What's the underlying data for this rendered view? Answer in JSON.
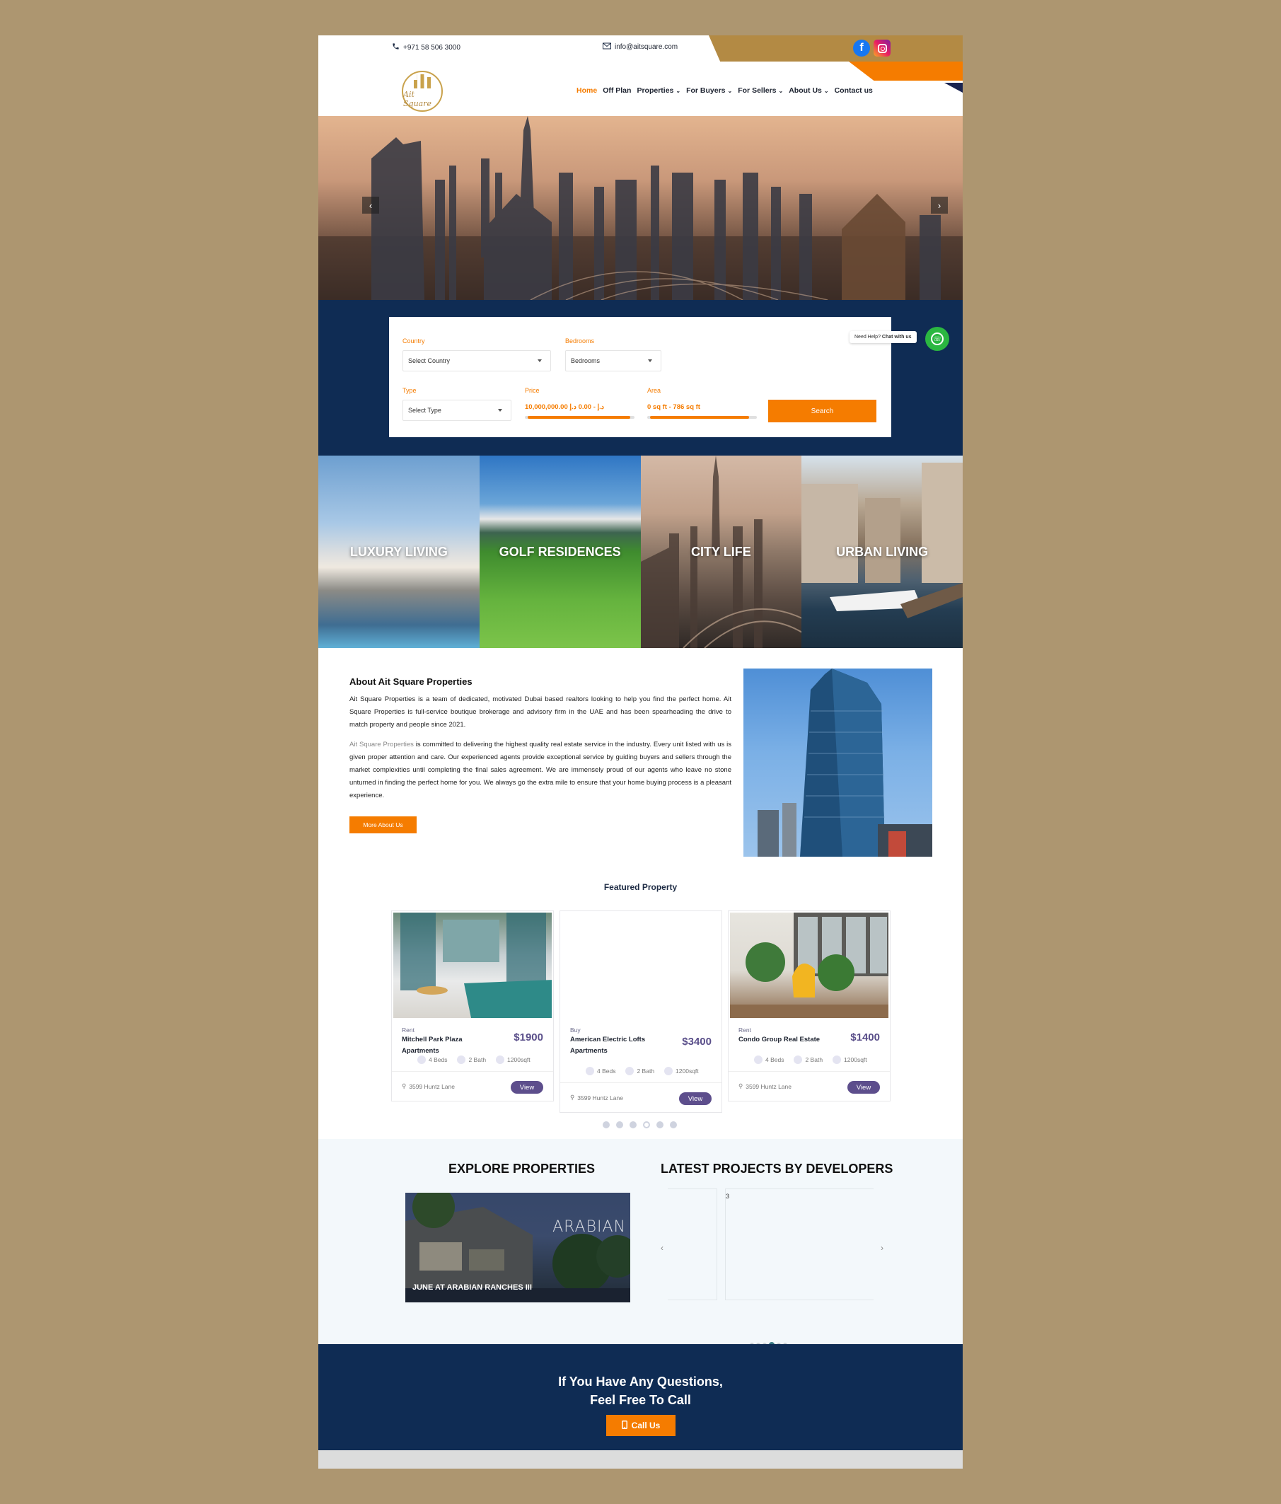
{
  "topbar": {
    "phone": "+971 58 506 3000",
    "email": "info@aitsquare.com",
    "social": [
      "facebook-icon",
      "instagram-icon"
    ]
  },
  "logo": {
    "text": "Ait Square"
  },
  "nav": {
    "items": [
      {
        "label": "Home",
        "active": true,
        "dropdown": false
      },
      {
        "label": "Off Plan",
        "active": false,
        "dropdown": false
      },
      {
        "label": "Properties",
        "active": false,
        "dropdown": true
      },
      {
        "label": "For Buyers",
        "active": false,
        "dropdown": true
      },
      {
        "label": "For Sellers",
        "active": false,
        "dropdown": true
      },
      {
        "label": "About Us",
        "active": false,
        "dropdown": true
      },
      {
        "label": "Contact us",
        "active": false,
        "dropdown": false
      }
    ]
  },
  "hero": {
    "prev": "‹",
    "next": "›"
  },
  "search": {
    "country_label": "Country",
    "country_value": "Select Country",
    "bedrooms_label": "Bedrooms",
    "bedrooms_value": "Bedrooms",
    "type_label": "Type",
    "type_value": "Select Type",
    "price_label": "Price",
    "price_value": "10,000,000.00 د.إ - 0.00 د.إ",
    "area_label": "Area",
    "area_value": "0 sq ft - 786 sq ft",
    "button": "Search"
  },
  "help": {
    "prefix": "Need Help?",
    "strong": "Chat with us"
  },
  "tiles": [
    "LUXURY LIVING",
    "GOLF RESIDENCES",
    "CITY LIFE",
    "URBAN LIVING"
  ],
  "about": {
    "title": "About Ait Square Properties",
    "p1": "Ait Square Properties is a team of dedicated, motivated Dubai based realtors looking to help you find the perfect home. Ait Square Properties is full-service boutique brokerage and advisory firm in the UAE and has been spearheading the drive to match property and people since 2021.",
    "p2_highlight": "Ait Square Properties",
    "p2": " is committed to delivering the highest quality real estate service in the industry. Every unit listed with us is given proper attention and care. Our experienced agents provide exceptional service by guiding buyers and sellers through the market complexities until completing the final sales agreement. We are immensely proud of our agents who leave no stone unturned in finding the perfect home for you. We always go the extra mile to ensure that your home buying process is a pleasant experience.",
    "button": "More About Us"
  },
  "featured": {
    "title": "Featured Property",
    "cards": [
      {
        "type": "Rent",
        "name": "Mitchell Park Plaza Apartments",
        "price": "$1900",
        "beds": "4 Beds",
        "bath": "2 Bath",
        "area": "1200sqft",
        "location": "3599 Huntz Lane",
        "view": "View"
      },
      {
        "type": "Buy",
        "name": "American Electric Lofts Apartments",
        "price": "$3400",
        "beds": "4 Beds",
        "bath": "2 Bath",
        "area": "1200sqft",
        "location": "3599 Huntz Lane",
        "view": "View"
      },
      {
        "type": "Rent",
        "name": "Condo Group Real Estate",
        "price": "$1400",
        "beds": "4 Beds",
        "bath": "2 Bath",
        "area": "1200sqft",
        "location": "3599 Huntz Lane",
        "view": "View"
      }
    ]
  },
  "explore": {
    "title": "EXPLORE PROPERTIES",
    "image_brand": "ARABIAN",
    "caption": "JUNE AT ARABIAN RANCHES III"
  },
  "projects": {
    "title": "LATEST PROJECTS BY DEVELOPERS",
    "slide_number": "3",
    "prev": "‹",
    "next": "›"
  },
  "cta": {
    "line1": "If You Have Any Questions,",
    "line2": "Feel Free To Call",
    "button": "Call Us"
  },
  "colors": {
    "accent": "#f57c00",
    "navy": "#0f2c54",
    "gold": "#b38a44",
    "purple": "#5d4e8c"
  }
}
